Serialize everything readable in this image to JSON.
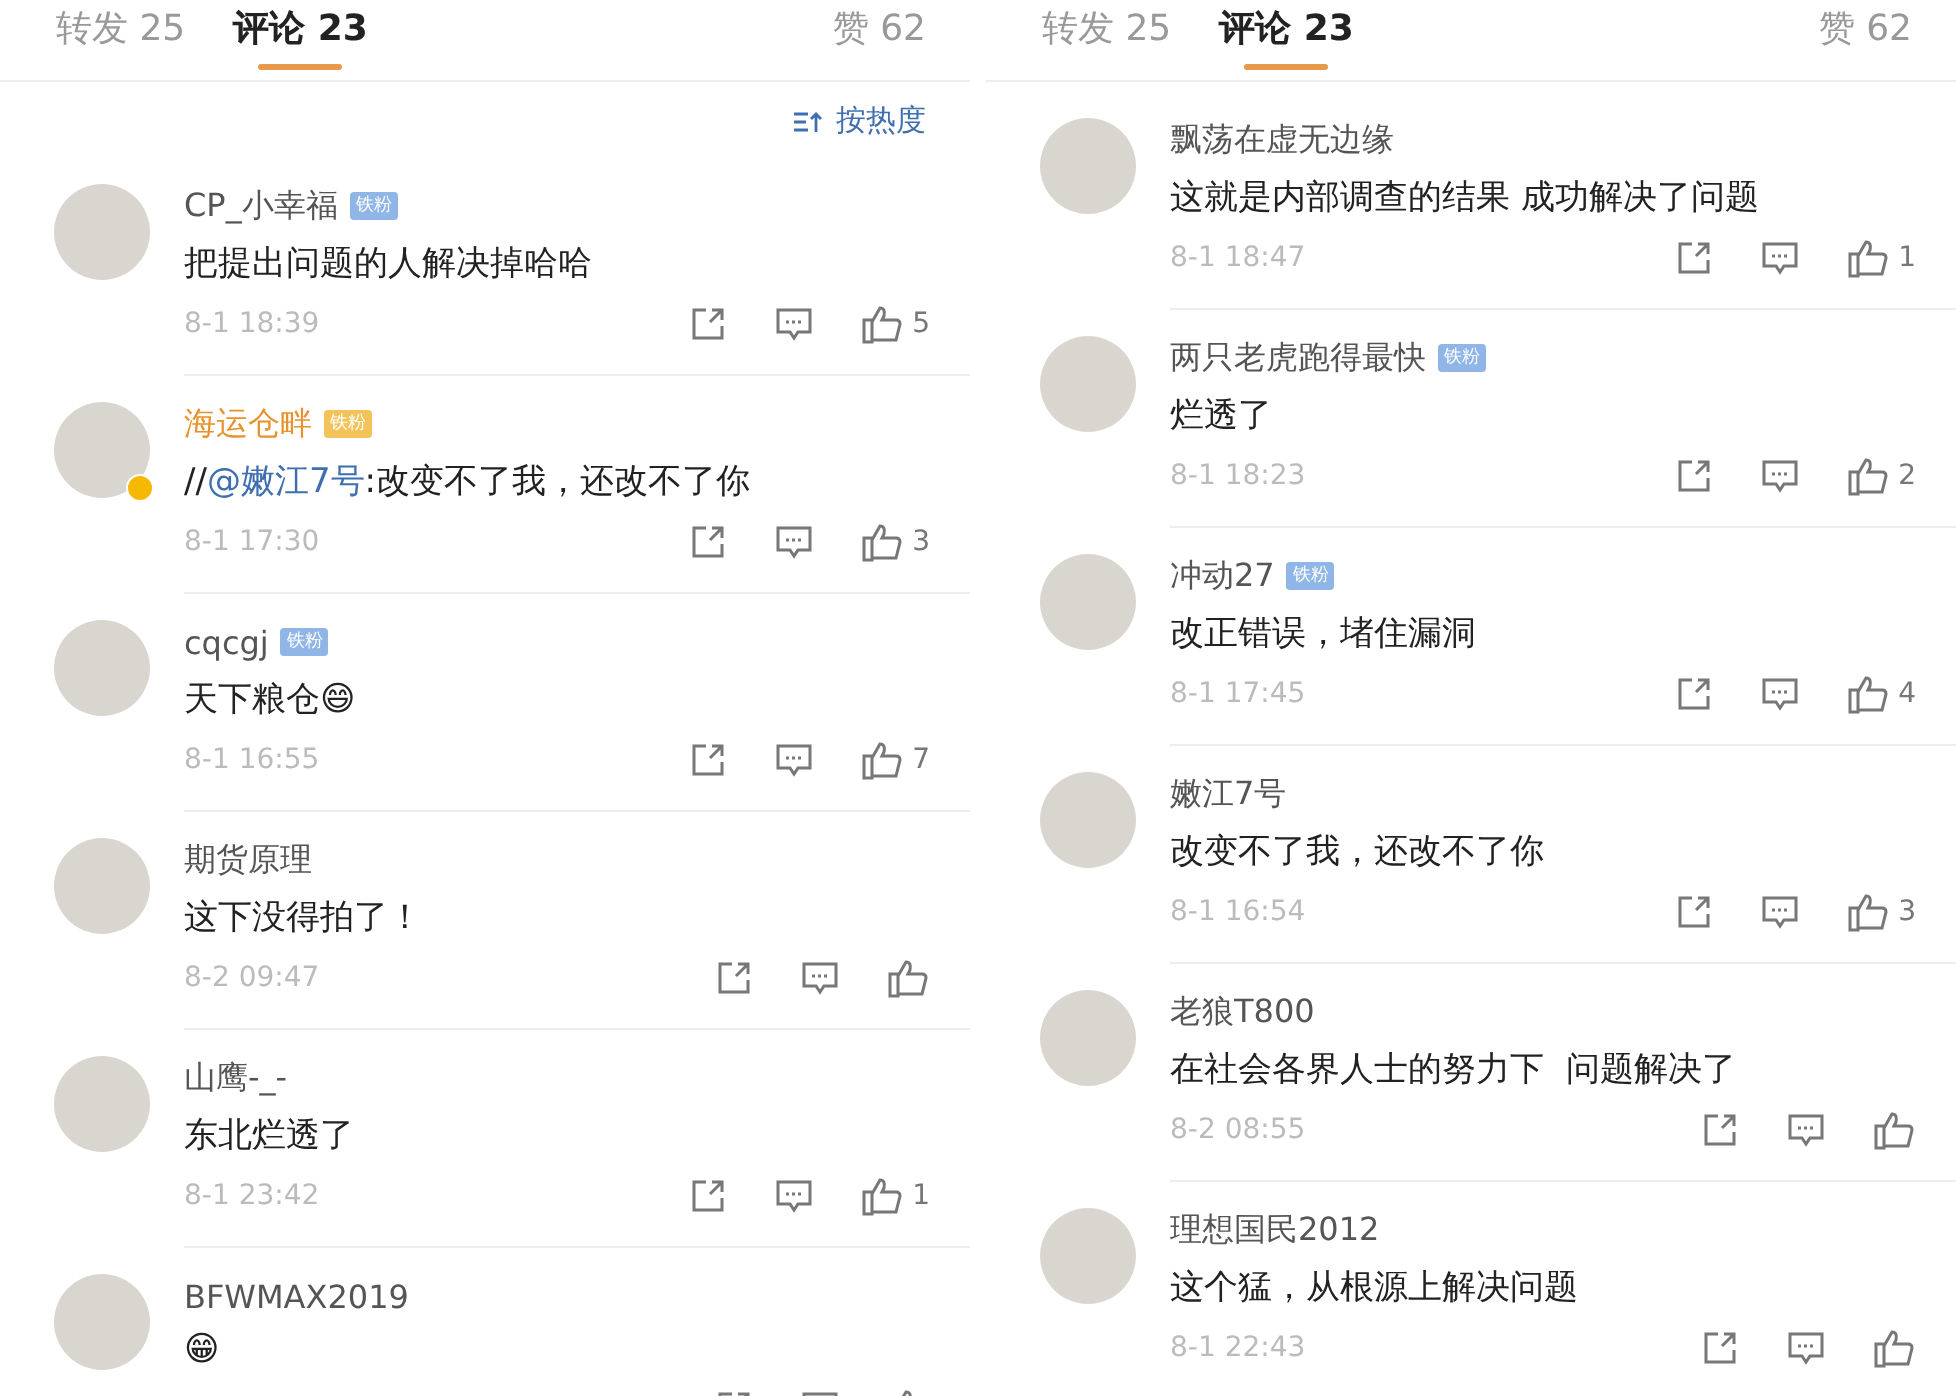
{
  "panels": [
    {
      "tabs": [
        {
          "label": "转发 25",
          "selected": false
        },
        {
          "label": "评论 23",
          "selected": true
        }
      ],
      "likes_tab": "赞 62",
      "sort_button": "按热度",
      "comments": [
        {
          "name": "CP_小幸福",
          "vip": false,
          "verified": false,
          "badge": {
            "text": "铁粉",
            "kind": "blue"
          },
          "text": [
            {
              "kind": "plain",
              "text": "把提出问题的人解决掉哈哈"
            }
          ],
          "time": "8-1 18:39",
          "likes": "5"
        },
        {
          "name": "海运仓畔",
          "vip": true,
          "verified": true,
          "badge": {
            "text": "铁粉",
            "kind": "gold"
          },
          "text": [
            {
              "kind": "plain",
              "text": "//"
            },
            {
              "kind": "mention",
              "text": "@嫩江7号"
            },
            {
              "kind": "plain",
              "text": ":改变不了我，还改不了你"
            }
          ],
          "time": "8-1 17:30",
          "likes": "3"
        },
        {
          "name": "cqcgj",
          "vip": false,
          "verified": false,
          "badge": {
            "text": "铁粉",
            "kind": "blue"
          },
          "text": [
            {
              "kind": "plain",
              "text": "天下粮仓😄"
            }
          ],
          "time": "8-1 16:55",
          "likes": "7"
        },
        {
          "name": "期货原理",
          "vip": false,
          "verified": false,
          "text": [
            {
              "kind": "plain",
              "text": "这下没得拍了！"
            }
          ],
          "time": "8-2 09:47"
        },
        {
          "name": "山鹰-_-",
          "vip": false,
          "verified": false,
          "text": [
            {
              "kind": "plain",
              "text": "东北烂透了"
            }
          ],
          "time": "8-1 23:42",
          "likes": "1"
        },
        {
          "name": "BFWMAX2019",
          "vip": false,
          "verified": false,
          "text": [
            {
              "kind": "plain",
              "text": "😁"
            }
          ]
        }
      ]
    },
    {
      "tabs": [
        {
          "label": "转发 25",
          "selected": false
        },
        {
          "label": "评论 23",
          "selected": true
        }
      ],
      "likes_tab": "赞 62",
      "comments": [
        {
          "name": "飘荡在虚无边缘",
          "vip": false,
          "verified": false,
          "text": [
            {
              "kind": "plain",
              "text": "这就是内部调查的结果 成功解决了问题"
            }
          ],
          "time": "8-1 18:47",
          "likes": "1"
        },
        {
          "name": "两只老虎跑得最快",
          "vip": false,
          "verified": false,
          "badge": {
            "text": "铁粉",
            "kind": "blue"
          },
          "text": [
            {
              "kind": "plain",
              "text": "烂透了"
            }
          ],
          "time": "8-1 18:23",
          "likes": "2"
        },
        {
          "name": "冲动27",
          "vip": false,
          "verified": false,
          "badge": {
            "text": "铁粉",
            "kind": "blue"
          },
          "text": [
            {
              "kind": "plain",
              "text": "改正错误，堵住漏洞"
            }
          ],
          "time": "8-1 17:45",
          "likes": "4"
        },
        {
          "name": "嫩江7号",
          "vip": false,
          "verified": false,
          "text": [
            {
              "kind": "plain",
              "text": "改变不了我，还改不了你"
            }
          ],
          "time": "8-1 16:54",
          "likes": "3"
        },
        {
          "name": "老狼T800",
          "vip": false,
          "verified": false,
          "text": [
            {
              "kind": "plain",
              "text": "在社会各界人士的努力下  问题解决了"
            }
          ],
          "time": "8-2 08:55"
        },
        {
          "name": "理想国民2012",
          "vip": false,
          "verified": false,
          "text": [
            {
              "kind": "plain",
              "text": "这个猛，从根源上解决问题"
            }
          ],
          "time": "8-1 22:43"
        }
      ]
    }
  ]
}
